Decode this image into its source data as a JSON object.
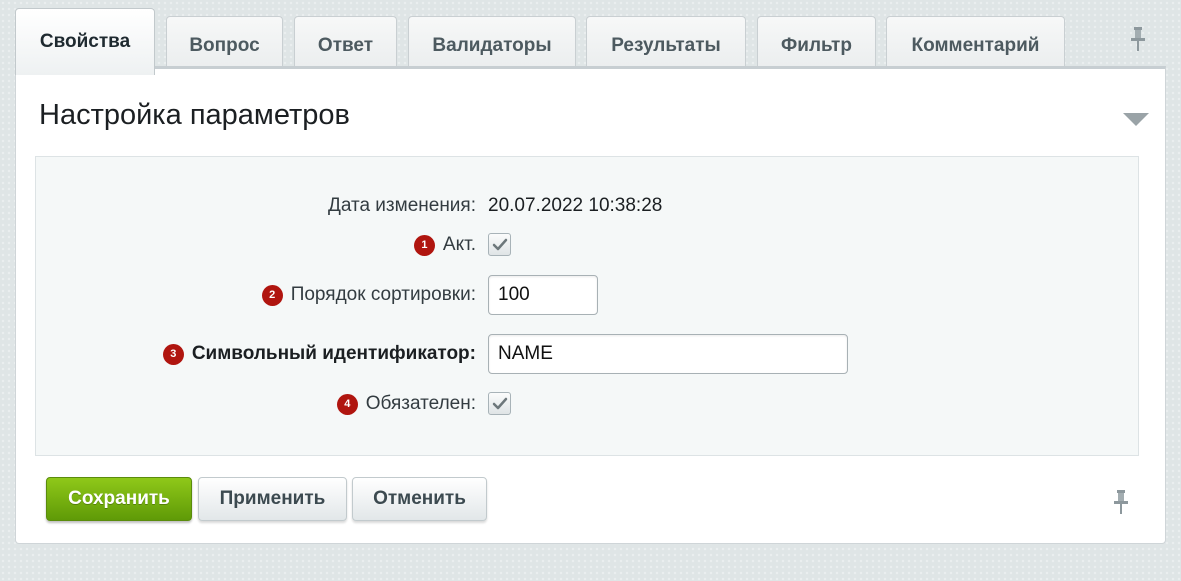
{
  "tabs": [
    {
      "label": "Свойства",
      "active": true
    },
    {
      "label": "Вопрос",
      "active": false
    },
    {
      "label": "Ответ",
      "active": false
    },
    {
      "label": "Валидаторы",
      "active": false
    },
    {
      "label": "Результаты",
      "active": false
    },
    {
      "label": "Фильтр",
      "active": false
    },
    {
      "label": "Комментарий",
      "active": false
    }
  ],
  "section": {
    "title": "Настройка параметров"
  },
  "form": {
    "date": {
      "label": "Дата изменения:",
      "value": "20.07.2022 10:38:28"
    },
    "active": {
      "marker": "1",
      "label": "Акт.",
      "checked": true
    },
    "sort": {
      "marker": "2",
      "label": "Порядок сортировки:",
      "value": "100"
    },
    "code": {
      "marker": "3",
      "label": "Символьный идентификатор:",
      "value": "NAME"
    },
    "required": {
      "marker": "4",
      "label": "Обязателен:",
      "checked": true
    }
  },
  "buttons": {
    "save": "Сохранить",
    "apply": "Применить",
    "cancel": "Отменить"
  },
  "icons": {
    "pin": "pin-icon",
    "collapse": "chevron-down-icon",
    "check": "check-icon"
  },
  "colors": {
    "accent_green": "#6aa80d",
    "marker_red": "#b0150f",
    "background": "#dfe5e6"
  }
}
